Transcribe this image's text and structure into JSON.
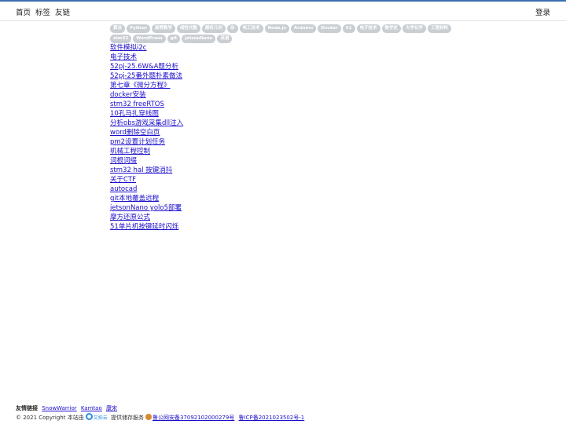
{
  "nav": {
    "items": [
      "首页",
      "标签",
      "友链"
    ],
    "login": "登录"
  },
  "tags": [
    "算法",
    "Python",
    "高等数学",
    "线性代数",
    "解析几何",
    "杂",
    "电工技术",
    "Node.js",
    "Arduino",
    "Docker",
    "51",
    "电子技术",
    "数学史",
    "大学化学",
    "工程材料",
    "stm32",
    "WordPress",
    "git",
    "jetsonNano",
    "英语"
  ],
  "posts": [
    "软件模拟i2c",
    "电子技术",
    "52pj-25.6W&A题分析",
    "52pj-25番外题朴素做法",
    "第七章《微分方程》",
    "docker安装",
    "stm32 freeRTOS",
    "10孔马扎穿线图",
    "分析obs游戏采集dll注入",
    "word删除空白页",
    "pm2设置计划任务",
    "机械工程控制",
    "词根词缀",
    "stm32 hal 按键消抖",
    "关于CTF",
    "autocad",
    "git本地覆盖远程",
    "jetsonNano yolo5部署",
    "摩方还原公式",
    "51单片机按键延时闪烁"
  ],
  "footer": {
    "links_label": "友情链接",
    "links": [
      "SnowWarrior",
      "Kamtao",
      "康宋"
    ],
    "copyright": "© 2021 Copyright 本站由",
    "cloud_name": "又拍云",
    "storage_text": "提供储存服务",
    "police_record": "鲁公网安备37092102000279号",
    "icp": "鲁ICP备2021023502号-1"
  }
}
